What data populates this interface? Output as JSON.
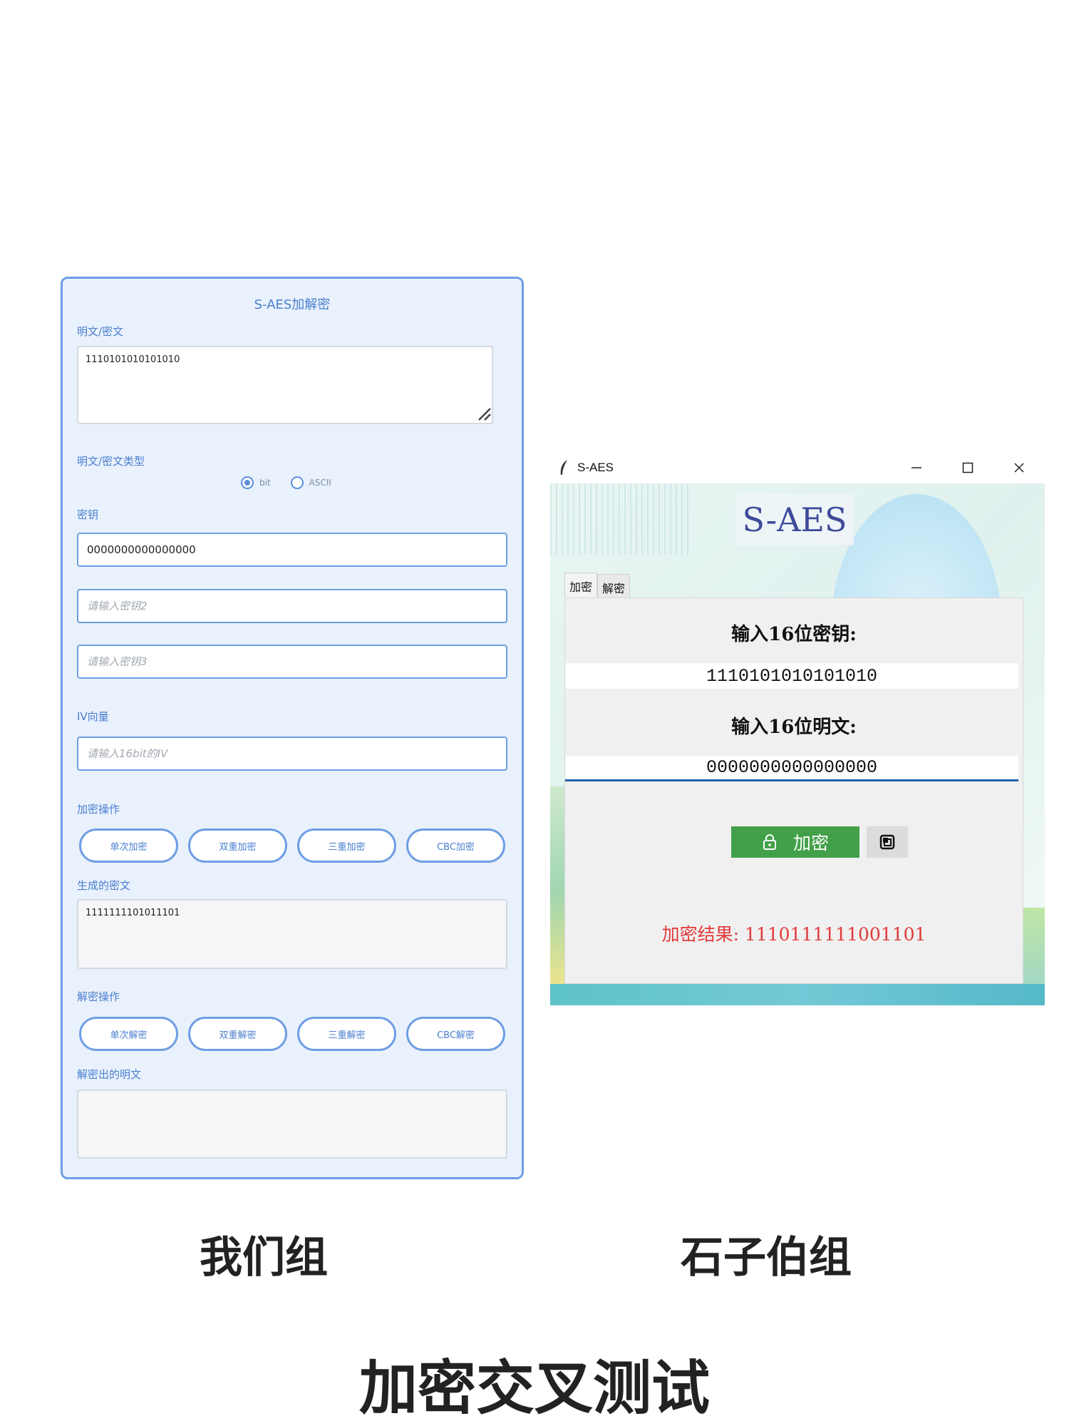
{
  "left_panel": {
    "title": "S-AES加解密",
    "plaintext_label": "明文/密文",
    "plaintext_value": "1110101010101010",
    "type_label": "明文/密文类型",
    "radio_options": [
      {
        "label": "bit",
        "checked": true
      },
      {
        "label": "ASCII",
        "checked": false
      }
    ],
    "key_label": "密钥",
    "key1_value": "0000000000000000",
    "key2_placeholder": "请输入密钥2",
    "key3_placeholder": "请输入密钥3",
    "iv_label": "IV向量",
    "iv_placeholder": "请输入16bit的IV",
    "encrypt_section_label": "加密操作",
    "encrypt_buttons": [
      "单次加密",
      "双重加密",
      "三重加密",
      "CBC加密"
    ],
    "ciphertext_label": "生成的密文",
    "ciphertext_value": "1111111101011101",
    "decrypt_section_label": "解密操作",
    "decrypt_buttons": [
      "单次解密",
      "双重解密",
      "三重解密",
      "CBC解密"
    ],
    "decrypted_label": "解密出的明文",
    "decrypted_value": ""
  },
  "right_app": {
    "window_title": "S-AES",
    "heading": "S-AES",
    "tabs": [
      {
        "label": "加密",
        "active": true
      },
      {
        "label": "解密",
        "active": false
      }
    ],
    "key_label": "输入16位密钥:",
    "key_value": "1110101010101010",
    "plaintext_label": "输入16位明文:",
    "plaintext_value": "0000000000000000",
    "encrypt_button": "加密",
    "result_text": "加密结果: 1110111111001101"
  },
  "captions": {
    "left": "我们组",
    "right": "石子伯组",
    "bottom": "加密交叉测试"
  },
  "colors": {
    "accent_blue": "#6f9ee3",
    "encrypt_green": "#43a04a",
    "result_red": "#e23a3a"
  }
}
